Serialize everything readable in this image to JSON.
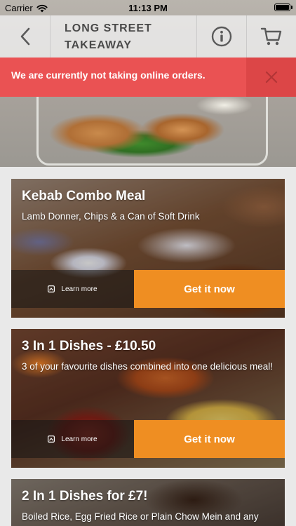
{
  "status_bar": {
    "carrier": "Carrier",
    "time": "11:13 PM"
  },
  "header": {
    "title": "LONG STREET\nTAKEAWAY"
  },
  "alert": {
    "message": "We are currently not taking online orders."
  },
  "cards": [
    {
      "title": "Kebab Combo Meal",
      "description": "Lamb Donner, Chips & a Can of Soft Drink",
      "learn_more": "Learn more",
      "cta": "Get it now"
    },
    {
      "title": "3 In 1 Dishes - £10.50",
      "description": "3 of your favourite dishes combined into one delicious meal!",
      "learn_more": "Learn more",
      "cta": "Get it now"
    },
    {
      "title": "2 In 1 Dishes for £7!",
      "description": "Boiled Rice, Egg Fried Rice or Plain Chow Mein and any"
    }
  ],
  "colors": {
    "alert": "#ea5253",
    "cta": "#ef8e22"
  },
  "icons": [
    "wifi-icon",
    "battery-icon",
    "back-chevron-icon",
    "info-icon",
    "cart-icon",
    "close-icon",
    "info-square-icon"
  ]
}
